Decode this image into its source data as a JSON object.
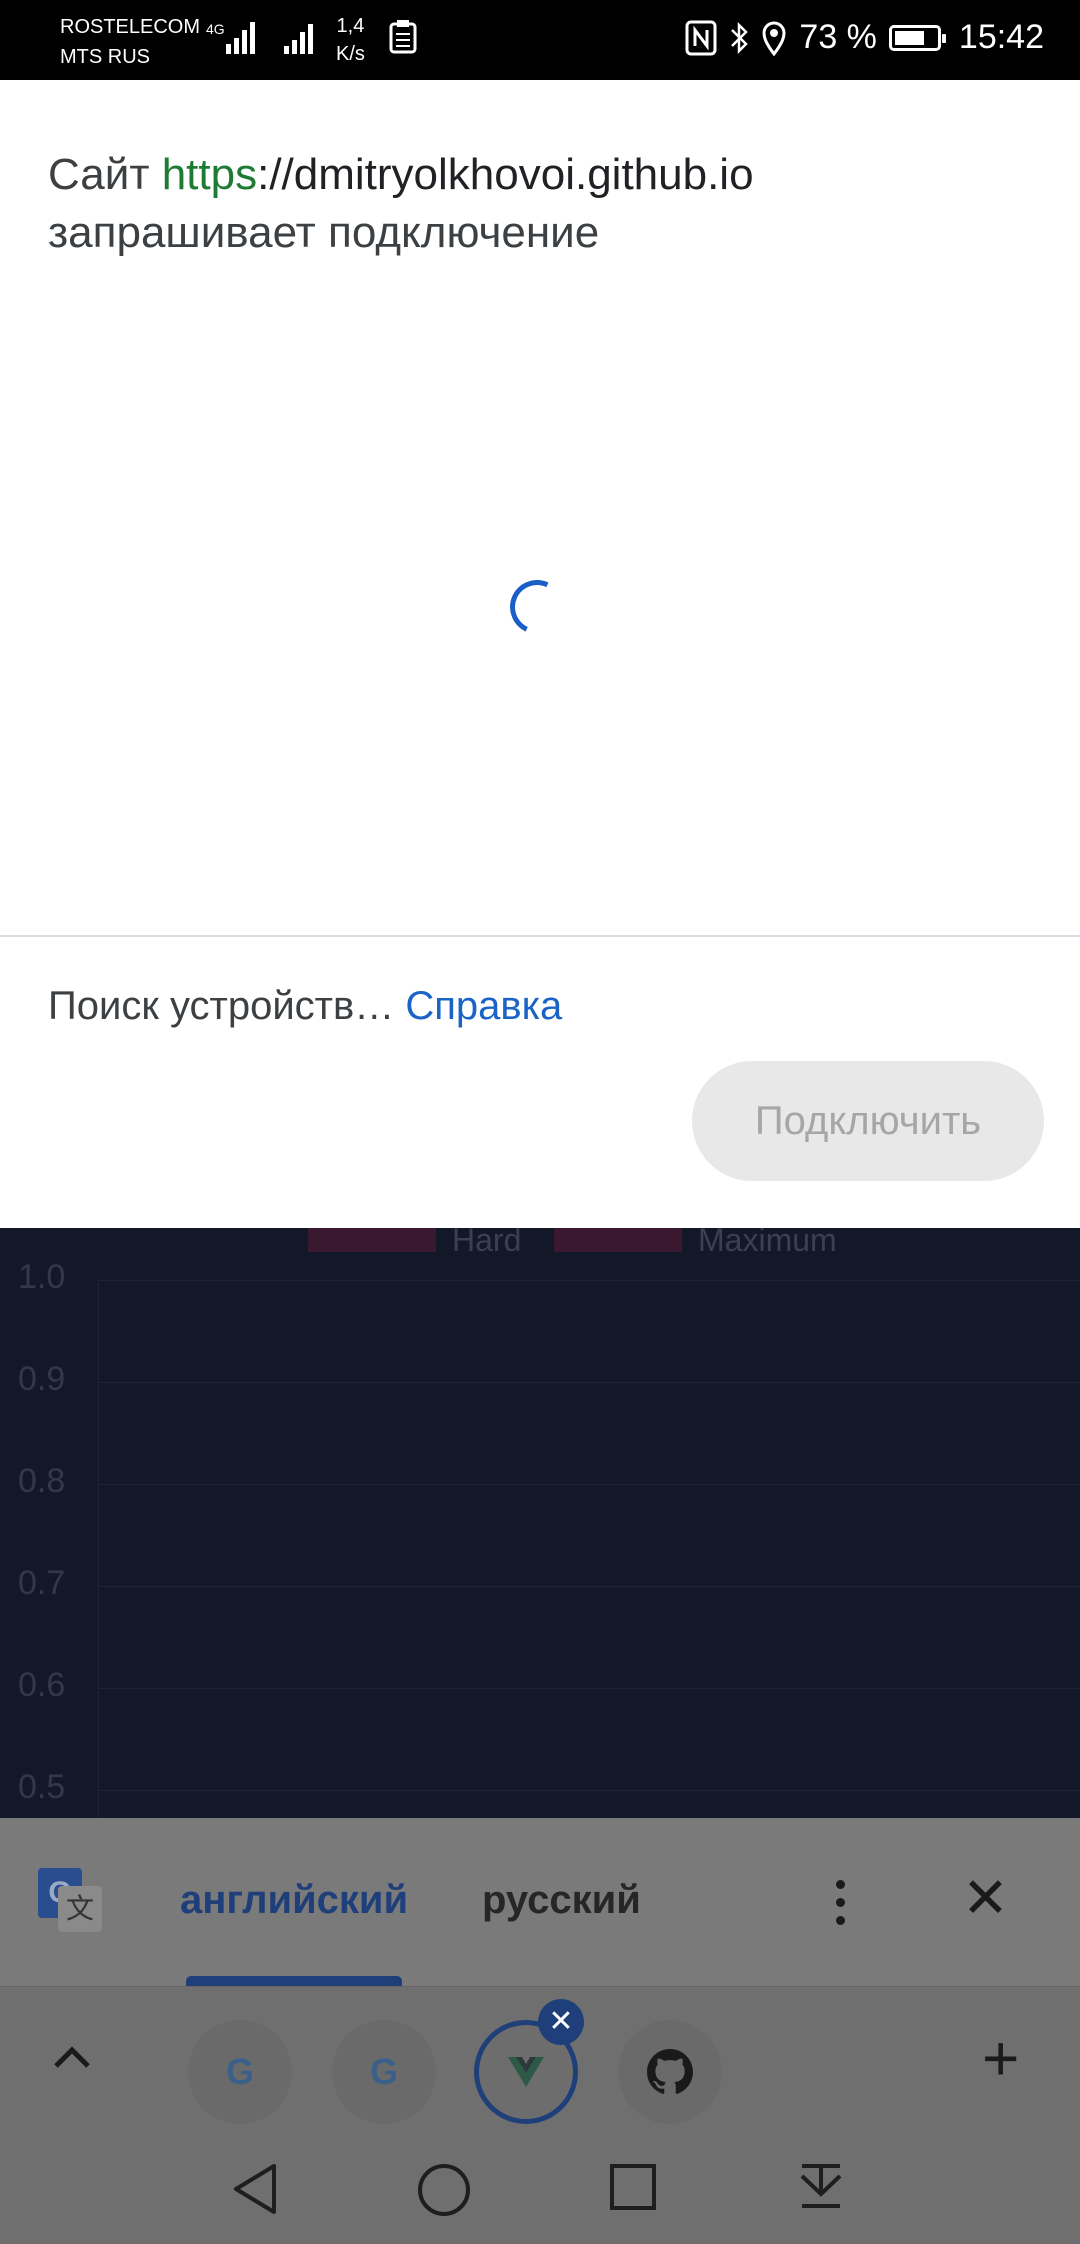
{
  "status_bar": {
    "carrier1": "ROSTELECOM",
    "carrier2": "MTS RUS",
    "network": "4G",
    "speed_value": "1,4",
    "speed_unit": "K/s",
    "battery": "73 %",
    "battery_level": 0.73,
    "time": "15:42",
    "icons": [
      "signal-icon",
      "clipboard-icon",
      "nfc-icon",
      "bluetooth-icon",
      "location-icon",
      "battery-icon"
    ]
  },
  "dialog": {
    "title_prefix": "Сайт ",
    "title_scheme": "https",
    "title_host": "://dmitryolkhovoi.github.io",
    "title_suffix": "запрашивает подключение",
    "status_text": "Поиск устройств… ",
    "help_link": "Справка",
    "connect_button": "Подключить"
  },
  "background_page": {
    "legend": [
      "Hard",
      "Maximum"
    ],
    "y_ticks": [
      "1.0",
      "0.9",
      "0.8",
      "0.7",
      "0.6",
      "0.5"
    ]
  },
  "translate_bar": {
    "source_lang": "английский",
    "target_lang": "русский"
  },
  "tab_strip": {
    "tabs": [
      "G",
      "G",
      "V",
      "github"
    ]
  },
  "colors": {
    "accent": "#1a63c7",
    "scheme_green": "#1e7b34",
    "page_bg": "#131828"
  }
}
